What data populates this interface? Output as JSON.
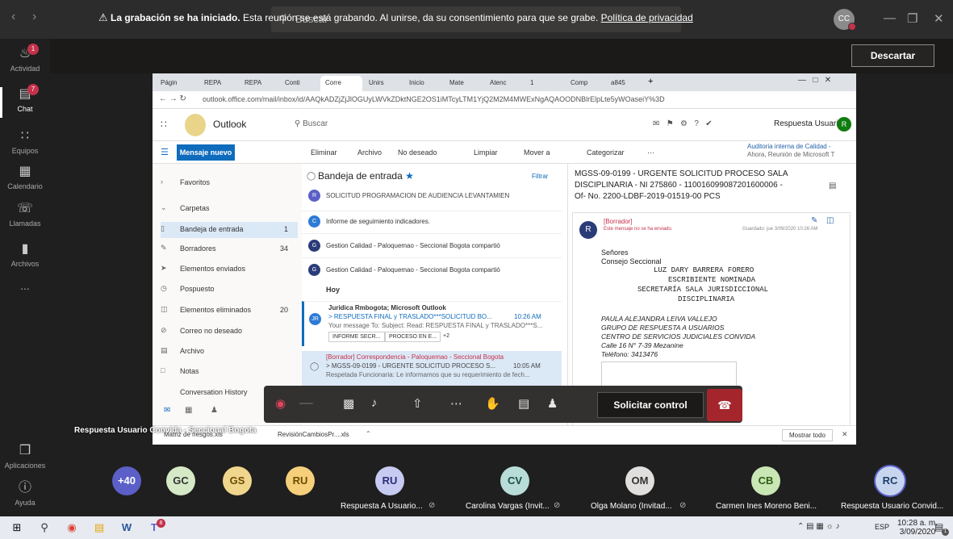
{
  "title_bar": {
    "search_placeholder": "Buscar",
    "my_avatar_initials": "CC"
  },
  "rail": [
    {
      "label": "Actividad",
      "badge": "1",
      "icon": "bell-icon"
    },
    {
      "label": "Chat",
      "badge": "7",
      "icon": "chat-icon",
      "active": true
    },
    {
      "label": "Equipos",
      "icon": "teams-icon"
    },
    {
      "label": "Calendario",
      "icon": "calendar-icon"
    },
    {
      "label": "Llamadas",
      "icon": "phone-icon"
    },
    {
      "label": "Archivos",
      "icon": "files-icon"
    },
    {
      "label": "...",
      "icon": "more-icon"
    },
    {
      "label": "Aplicaciones",
      "icon": "apps-icon"
    },
    {
      "label": "Ayuda",
      "icon": "help-icon"
    }
  ],
  "banner": {
    "bold": "La grabación se ha iniciado.",
    "text": " Esta reunión se está grabando. Al unirse, da su consentimiento para que se grabe. ",
    "link": "Política de privacidad",
    "dismiss": "Descartar"
  },
  "shared_screen": {
    "browser_tabs": [
      "Págin",
      "REPA",
      "REPA",
      "Conti",
      "Corre",
      "Unirs",
      "Inicio",
      "Mate",
      "Atenc",
      "1",
      "Comp",
      "a845"
    ],
    "url": "outlook.office.com/mail/inbox/id/AAQkADZjZjJlOGUyLWVkZDktNGE2OS1iMTcyLTM1YjQ2M2M4MWExNgAQAOODNBlrElpLte5yWOaseiY%3D",
    "outlook": {
      "app_name": "Outlook",
      "search": "Buscar",
      "user": "Respuesta Usuari...",
      "user_initial": "R",
      "new_mail": "Mensaje nuevo",
      "toolbar": [
        "Eliminar",
        "Archivo",
        "No deseado",
        "Limpiar",
        "Mover a",
        "Categorizar",
        "···"
      ],
      "toolbar_right": [
        "Auditoria interna de Calidad -",
        "Ahora, Reunión de Microsoft T"
      ],
      "folders": [
        {
          "label": "Favoritos",
          "icon": ">"
        },
        {
          "label": "Carpetas",
          "icon": "v"
        },
        {
          "label": "Bandeja de entrada",
          "count": "1",
          "active": true
        },
        {
          "label": "Borradores",
          "count": "34"
        },
        {
          "label": "Elementos enviados"
        },
        {
          "label": "Pospuesto"
        },
        {
          "label": "Elementos eliminados",
          "count": "20"
        },
        {
          "label": "Correo no deseado"
        },
        {
          "label": "Archivo"
        },
        {
          "label": "Notas"
        },
        {
          "label": "Conversation History"
        }
      ],
      "inbox_title": "Bandeja de entrada",
      "filter": "Filtrar",
      "messages": [
        {
          "line": "SOLICITUD PROGRAMACION DE AUDIENCIA LEVANTAMIEN"
        },
        {
          "line": "Informe de seguimiento indicadores."
        },
        {
          "line": "Gestion Calidad - Paloquemao - Seccional Bogota compartió"
        },
        {
          "line": "Gestion Calidad - Paloquemao - Seccional Bogota compartió"
        }
      ],
      "group_today": "Hoy",
      "msg_today": {
        "from": "Juridica Rmbogota; Microsoft Outlook",
        "subject": "RESPUESTA FINAL y TRASLADO***SOLICITUD BO...",
        "time": "10:26 AM",
        "preview": "Your message To: Subject: Read: RESPUESTA FINAL y TRASLADO***S...",
        "att1": "INFORME SECR...",
        "att2": "PROCESO EN E...",
        "more": "+2"
      },
      "msg_draft": {
        "from": "[Borrador] Correspondencia - Paloquemao - Seccional Bogota",
        "subject": "MGSS-09-0199 - URGENTE SOLICITUD PROCESO S...",
        "time": "10:05 AM",
        "preview": "Respetada Funcionaria: Le informamos que su requerimiento de fech..."
      },
      "reading": {
        "subject_1": "MGSS-09-0199 - URGENTE SOLICITUD PROCESO SALA",
        "subject_2": "DISCIPLINARIA - NI 275860 - 110016099087201600006 -",
        "subject_3": "Of- No. 2200-LDBF-2019-01519-00 PCS",
        "draft_tag": "[Borrador]",
        "not_sent": "Este mensaje no se ha enviado.",
        "saved": "Guardado: jue 3/09/2020 10:26 AM",
        "body_1": "Señores",
        "body_2": "Consejo Seccional",
        "mono_1": "LUZ DARY BARRERA FORERO",
        "mono_2": "ESCRIBIENTE NOMINADA",
        "mono_3": "SECRETARÍA SALA JURISDICCIONAL",
        "mono_4": "DISCIPLINARIA",
        "sig_1": "PAULA ALEJANDRA LEIVA VALLEJO",
        "sig_2": "GRUPO DE RESPUESTA A USUARIOS",
        "sig_3": "CENTRO DE SERVICIOS JUDICIALES CONVIDA",
        "sig_4": "Calle 16 N° 7-39 Mezanine",
        "sig_5": "Teléfono: 3413476"
      },
      "downloads": [
        "Matriz de riesgos.xls",
        "RevisiónCambiosPr....xls"
      ],
      "show_all": "Mostrar todo"
    }
  },
  "call": {
    "request_control": "Solicitar control",
    "presenter": "Respuesta Usuario Convida - Seccional Bogota"
  },
  "participants": [
    {
      "initials": "+40",
      "name": "",
      "bg": "#5b5fc7",
      "fg": "#ffffff"
    },
    {
      "initials": "GC",
      "name": "",
      "bg": "#d6e9c6",
      "fg": "#333333"
    },
    {
      "initials": "GS",
      "name": "",
      "bg": "#f0d58c",
      "fg": "#6b4c00"
    },
    {
      "initials": "RU",
      "name": "",
      "bg": "#f5cf7a",
      "fg": "#6b4c00"
    },
    {
      "initials": "RU",
      "name": "Respuesta A Usuario...",
      "bg": "#c7cbf1",
      "fg": "#2b2f7a"
    },
    {
      "initials": "CV",
      "name": "Carolina Vargas (Invit...",
      "bg": "#b8dcd8",
      "fg": "#1b4d47"
    },
    {
      "initials": "OM",
      "name": "Olga Molano (Invitad...",
      "bg": "#e1dfdd",
      "fg": "#333333"
    },
    {
      "initials": "CB",
      "name": "Carmen Ines Moreno Beni...",
      "bg": "#c9e6b5",
      "fg": "#2e5e12"
    },
    {
      "initials": "RC",
      "name": "Respuesta Usuario Convid...",
      "bg": "#c7d6ee",
      "fg": "#1f3e6b"
    }
  ],
  "taskbar": {
    "lang": "ESP",
    "time": "10:28 a. m.",
    "date": "3/09/2020",
    "teams_badge": "8",
    "notif_badge": "1"
  }
}
